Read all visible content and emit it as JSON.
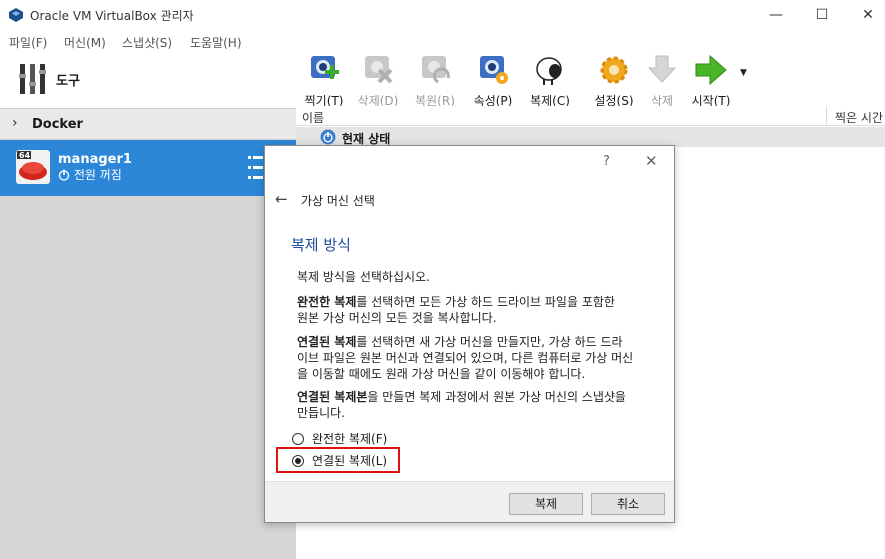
{
  "window": {
    "title": "Oracle VM VirtualBox 관리자",
    "minimize": "—",
    "maximize": "☐",
    "close": "✕"
  },
  "menu": [
    "파일(F)",
    "머신(M)",
    "스냅샷(S)",
    "도움말(H)"
  ],
  "sidebar": {
    "tools_label": "도구",
    "group_label": "Docker",
    "vm": {
      "name": "manager1",
      "state": "전원 꺼짐",
      "badge": "64"
    }
  },
  "toolbar": {
    "take": "찍기(T)",
    "delete": "삭제(D)",
    "restore": "복원(R)",
    "properties": "속성(P)",
    "clone": "복제(C)",
    "settings": "설정(S)",
    "remove": "삭제",
    "start": "시작(T)"
  },
  "snapshots": {
    "col_name": "이름",
    "col_taken": "찍은 시간",
    "current_state": "현재 상태"
  },
  "dialog": {
    "help": "?",
    "close": "✕",
    "back": "←",
    "title": "가상 머신 선택",
    "heading": "복제 방식",
    "intro": "복제 방식을 선택하십시오.",
    "p1_bold": "완전한 복제",
    "p1_rest_a": "를 선택하면 모든 가상 하드 드라이브 파일을 포함한",
    "p1_rest_b": "원본 가상 머신의 모든 것을 복사합니다.",
    "p2_bold": "연결된 복제",
    "p2_rest_a": "를 선택하면 새 가상 머신을 만들지만, 가상 하드 드라",
    "p2_rest_b": "이브 파일은 원본 머신과 연결되어 있으며, 다른 컴퓨터로 가상 머신",
    "p2_rest_c": "을 이동할 때에도 원래 가상 머신을 같이 이동해야 합니다.",
    "p3_bold": "연결된 복제본",
    "p3_rest_a": "을 만들면 복제 과정에서 원본 가상 머신의 스냅샷을",
    "p3_rest_b": "만듭니다.",
    "option_full": "완전한 복제(F)",
    "option_linked": "연결된 복제(L)",
    "selected": "linked",
    "btn_clone": "복제",
    "btn_cancel": "취소"
  },
  "colors": {
    "selection": "#2c87d8",
    "heading": "#1f4e9c",
    "highlight": "#e01010"
  }
}
